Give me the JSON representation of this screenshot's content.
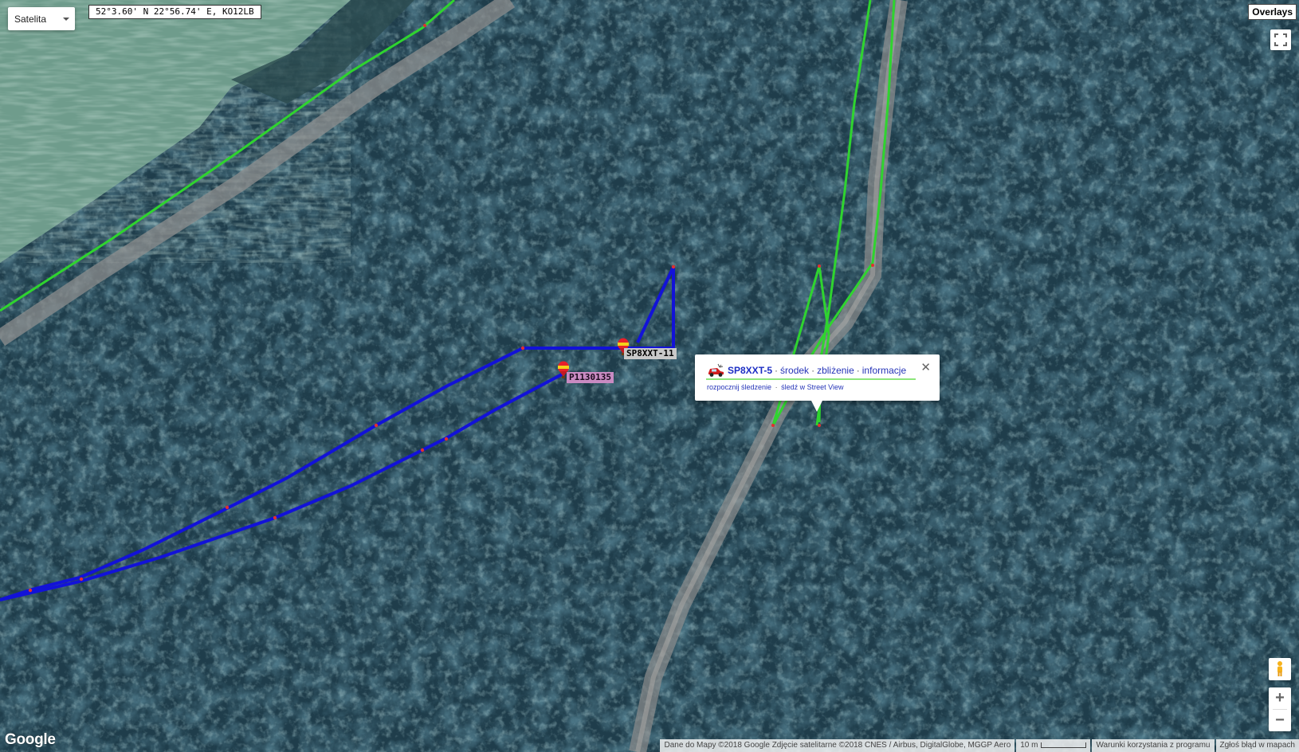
{
  "map_type": {
    "label": "Satelita"
  },
  "coordinates": "52°3.60' N 22°56.74' E, KO12LB",
  "overlays_button": "Overlays",
  "stations": [
    {
      "callsign": "SP8XXT-11",
      "label_color": "#c9c9c9"
    },
    {
      "callsign": "P1130135",
      "label_color": "#c98bc2"
    }
  ],
  "infowindow": {
    "callsign": "SP8XXT-5",
    "links": [
      "środek",
      "zbliżenie",
      "informacje"
    ],
    "actions": [
      "rozpocznij śledzenie",
      "śledź w Street View"
    ],
    "close_symbol": "✕"
  },
  "zoom": {
    "in_label": "+",
    "out_label": "−"
  },
  "branding": "Google",
  "attribution": "Dane do Mapy ©2018 Google Zdjęcie satelitarne ©2018 CNES / Airbus, DigitalGlobe, MGGP Aero",
  "scale_label": "10 m",
  "terms_link": "Warunki korzystania z programu",
  "report_link": "Zgłoś błąd w mapach",
  "colors": {
    "track_blue": "#1212d8",
    "track_green": "#2fd42f",
    "road": "#8f8f8f",
    "forest": "#1d3a48"
  },
  "icons": [
    "balloon-icon",
    "car-icon",
    "close-icon",
    "fullscreen-icon",
    "pegman-icon",
    "chevron-down-icon"
  ]
}
